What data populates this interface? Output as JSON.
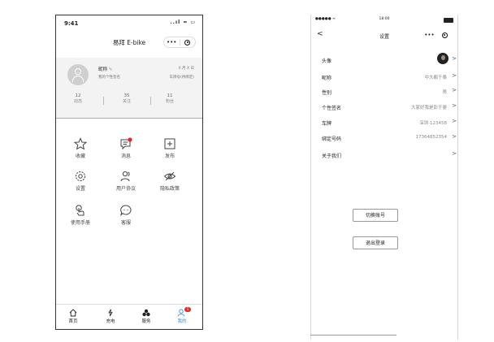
{
  "left": {
    "status_time": "9:41",
    "status_icons": "..ıl ≈ ▭",
    "title": "易拜 E-bike",
    "capsule_more": "•••",
    "profile": {
      "nickname": "昵称",
      "signature": "我的个性签名",
      "date_label": "X 月 X 日",
      "plate_label": "车牌号(待绑定)"
    },
    "stats": [
      {
        "num": "12",
        "label": "动态"
      },
      {
        "num": "35",
        "label": "关注"
      },
      {
        "num": "11",
        "label": "粉丝"
      }
    ],
    "menu": [
      {
        "label": "收藏",
        "icon": "star-icon"
      },
      {
        "label": "消息",
        "icon": "message-icon"
      },
      {
        "label": "发布",
        "icon": "plus-square-icon"
      },
      {
        "label": "设置",
        "icon": "gear-icon"
      },
      {
        "label": "用户协议",
        "icon": "users-icon"
      },
      {
        "label": "隐私政策",
        "icon": "eye-off-icon"
      },
      {
        "label": "使用手册",
        "icon": "hand-icon"
      },
      {
        "label": "客服",
        "icon": "chat-bubble-icon"
      }
    ],
    "tabs": [
      {
        "label": "首页",
        "icon": "home-icon"
      },
      {
        "label": "充电",
        "icon": "charge-icon"
      },
      {
        "label": "服务",
        "icon": "service-icon"
      },
      {
        "label": "我的",
        "icon": "profile-icon"
      }
    ],
    "active_tab": "我的",
    "tab_badge": "1",
    "accent": "#3a8fd8"
  },
  "right": {
    "status_carrier": "●●●●● ≈",
    "status_time": "18:00",
    "title": "设置",
    "back_glyph": "<",
    "rows": [
      {
        "label": "头像",
        "value": ""
      },
      {
        "label": "昵称",
        "value": "中大都于桑"
      },
      {
        "label": "性别",
        "value": "男"
      },
      {
        "label": "个性签名",
        "value": "大家好我是彭于晏"
      },
      {
        "label": "车牌",
        "value": "深圳·123458"
      },
      {
        "label": "绑定号码",
        "value": "17364852354"
      },
      {
        "label": "关于我们",
        "value": ""
      }
    ],
    "chevron": ">",
    "switch_account": "切换账号",
    "logout": "退出登录"
  }
}
